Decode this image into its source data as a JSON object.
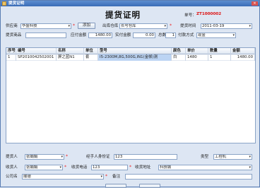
{
  "window": {
    "title": "提货证明"
  },
  "header": {
    "title": "提货证明",
    "doc_no_label": "单号：",
    "doc_no": "ZT1000002"
  },
  "row1": {
    "supplier_label": "供应商",
    "supplier_value": "华盛科技",
    "add_label": "添加",
    "warehouse_label": "出库仓库",
    "warehouse_value": "长号仓库",
    "date_label": "提货时间",
    "date_value": "2011-03-19"
  },
  "row2": {
    "goods_label": "提货商品",
    "payable_label": "应付金额",
    "payable_value": "1480.00",
    "paid_label": "实付金额",
    "paid_value": "0.00",
    "total_label": "总数",
    "total_value": "1",
    "paymethod_label": "付款方式",
    "paymethod_value": "现金"
  },
  "table": {
    "columns": [
      "序号",
      "编号",
      "名称",
      "单位",
      "型号",
      "颜色",
      "单价",
      "数量",
      "金额"
    ],
    "rows": [
      [
        "1",
        "SP2010042502001",
        "屏之蓝N1",
        "套",
        "I5-2300M,8G,500G,IN1(金帧)测",
        "白",
        "1480",
        "1",
        "1480.00"
      ]
    ]
  },
  "bottom": {
    "picker_label": "提货人",
    "picker_value": "张娟娟",
    "id_label": "经手人身份证",
    "id_value": "123",
    "type_label": "类型",
    "type_value": "工程机",
    "receiver_label": "收货人",
    "receiver_value": "张娟娟",
    "phone_label": "收货电话",
    "phone_value": "123",
    "address_label": "收货地址",
    "address_value": "科技城",
    "company_label": "公司名",
    "company_value": "顺德",
    "remark_label": "备注"
  },
  "colors": {
    "title_bar": "#3a6cb6",
    "doc_no": "#dd1111",
    "required": "#ee2222",
    "selected_cell": "#bcd4f3"
  }
}
